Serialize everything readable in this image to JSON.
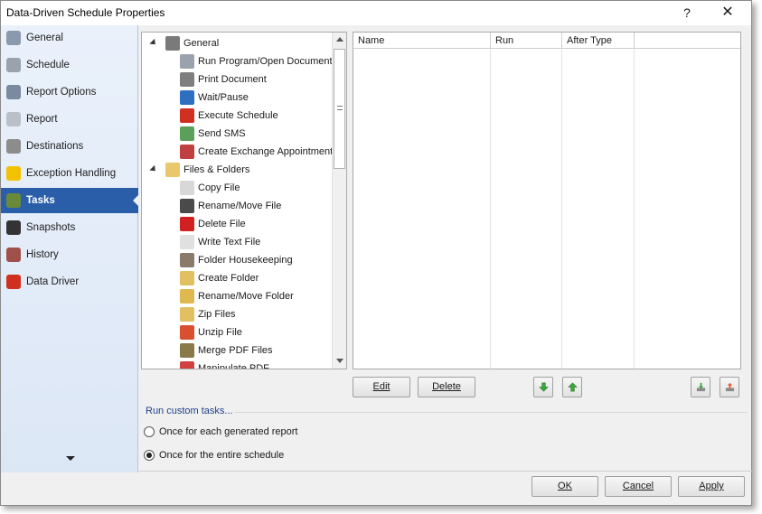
{
  "window": {
    "title": "Data-Driven Schedule Properties",
    "help_label": "?",
    "close_label": "✕"
  },
  "sidebar": {
    "items": [
      {
        "label": "General",
        "icon": "info-icon",
        "color": "#8b99ad"
      },
      {
        "label": "Schedule",
        "icon": "clock-icon",
        "color": "#9aa3ad"
      },
      {
        "label": "Report Options",
        "icon": "report-options-icon",
        "color": "#7a8aa0"
      },
      {
        "label": "Report",
        "icon": "report-icon",
        "color": "#b9c0c8"
      },
      {
        "label": "Destinations",
        "icon": "destinations-icon",
        "color": "#8c8c8c"
      },
      {
        "label": "Exception Handling",
        "icon": "warning-icon",
        "color": "#f2c200"
      },
      {
        "label": "Tasks",
        "icon": "tasks-icon",
        "color": "#6a8a3a"
      },
      {
        "label": "Snapshots",
        "icon": "camera-icon",
        "color": "#333333"
      },
      {
        "label": "History",
        "icon": "history-icon",
        "color": "#a0504a"
      },
      {
        "label": "Data Driver",
        "icon": "data-driver-icon",
        "color": "#d03020"
      }
    ],
    "active_index": 6
  },
  "tree": {
    "items": [
      {
        "label": "General",
        "level": 0,
        "icon": "gear-icon",
        "color": "#7a7a7a"
      },
      {
        "label": "Run Program/Open Document",
        "level": 1,
        "icon": "run-program-icon",
        "color": "#9aa3ad"
      },
      {
        "label": "Print Document",
        "level": 1,
        "icon": "printer-icon",
        "color": "#7f7f7f"
      },
      {
        "label": "Wait/Pause",
        "level": 1,
        "icon": "pause-icon",
        "color": "#2f6fc0"
      },
      {
        "label": "Execute Schedule",
        "level": 1,
        "icon": "execute-icon",
        "color": "#d03020"
      },
      {
        "label": "Send SMS",
        "level": 1,
        "icon": "sms-icon",
        "color": "#5aa05a"
      },
      {
        "label": "Create Exchange Appointment",
        "level": 1,
        "icon": "calendar-icon",
        "color": "#c04040"
      },
      {
        "label": "Files & Folders",
        "level": 0,
        "icon": "folder-icon",
        "color": "#e8c86a"
      },
      {
        "label": "Copy File",
        "level": 1,
        "icon": "copy-icon",
        "color": "#d8d8d8"
      },
      {
        "label": "Rename/Move File",
        "level": 1,
        "icon": "rename-file-icon",
        "color": "#4a4a4a"
      },
      {
        "label": "Delete File",
        "level": 1,
        "icon": "delete-icon",
        "color": "#d02020"
      },
      {
        "label": "Write Text File",
        "level": 1,
        "icon": "write-file-icon",
        "color": "#e0e0e0"
      },
      {
        "label": "Folder Housekeeping",
        "level": 1,
        "icon": "housekeeping-icon",
        "color": "#8a7a6a"
      },
      {
        "label": "Create Folder",
        "level": 1,
        "icon": "create-folder-icon",
        "color": "#e0c060"
      },
      {
        "label": "Rename/Move Folder",
        "level": 1,
        "icon": "rename-folder-icon",
        "color": "#e0b850"
      },
      {
        "label": "Zip Files",
        "level": 1,
        "icon": "zip-icon",
        "color": "#e0c060"
      },
      {
        "label": "Unzip File",
        "level": 1,
        "icon": "unzip-icon",
        "color": "#d85030"
      },
      {
        "label": "Merge PDF Files",
        "level": 1,
        "icon": "merge-pdf-icon",
        "color": "#8a7a4a"
      },
      {
        "label": "Manipulate PDF",
        "level": 1,
        "icon": "pdf-icon",
        "color": "#d04040"
      }
    ]
  },
  "grid": {
    "columns": [
      "Name",
      "Run",
      "After Type",
      ""
    ]
  },
  "actions": {
    "edit_label": "Edit",
    "delete_label": "Delete"
  },
  "run_custom": {
    "label": "Run custom tasks...",
    "options": [
      {
        "label": "Once for each generated report",
        "selected": false
      },
      {
        "label": "Once for the entire schedule",
        "selected": true
      }
    ]
  },
  "footer": {
    "ok_label": "OK",
    "cancel_label": "Cancel",
    "apply_label": "Apply"
  }
}
